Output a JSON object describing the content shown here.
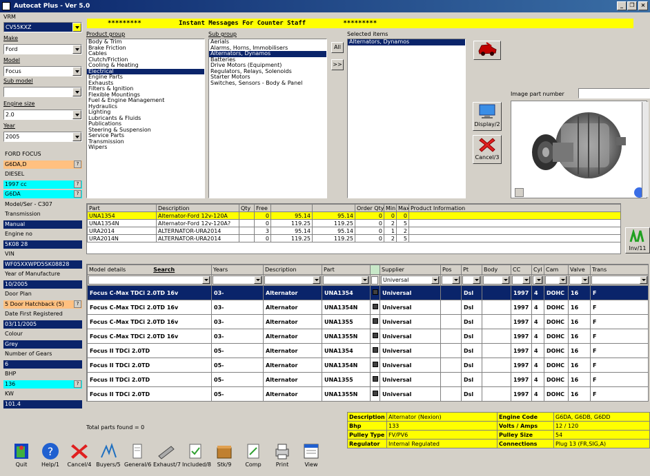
{
  "title": "Autocat Plus - Ver 5.0",
  "window_controls": {
    "min": "_",
    "restore": "❐",
    "close": "×"
  },
  "message": "*********          Instant Messages For Counter Staff          *********",
  "left": {
    "vrm_label": "VRM",
    "vrm_value": "CV55KXZ",
    "make_label": "Make",
    "make_value": "Ford",
    "model_label": "Model",
    "model_value": "Focus",
    "submodel_label": "Sub model",
    "submodel_value": "",
    "engine_label": "Engine size",
    "engine_value": "2.0",
    "year_label": "Year",
    "year_value": "2005",
    "rows": [
      {
        "text": "FORD FOCUS",
        "style": "gray",
        "btn": ""
      },
      {
        "text": "G6DA,D",
        "style": "orange",
        "btn": "?"
      },
      {
        "text": "DIESEL",
        "style": "gray",
        "btn": ""
      },
      {
        "text": "1997 cc",
        "style": "cyan",
        "btn": "?"
      },
      {
        "text": "G6DA",
        "style": "cyan",
        "btn": "?"
      },
      {
        "text": "Model/Ser - C307",
        "style": "gray",
        "btn": ""
      },
      {
        "text": "Transmission",
        "style": "gray",
        "btn": ""
      },
      {
        "text": "Manual",
        "style": "navy",
        "btn": ""
      },
      {
        "text": "Engine no",
        "style": "gray",
        "btn": ""
      },
      {
        "text": "5K08 28",
        "style": "navy",
        "btn": ""
      },
      {
        "text": "VIN",
        "style": "gray",
        "btn": ""
      },
      {
        "text": "WF05XXWPD5SK08828",
        "style": "navy",
        "btn": ""
      },
      {
        "text": "Year of Manufacture",
        "style": "gray",
        "btn": ""
      },
      {
        "text": "10/2005",
        "style": "navy",
        "btn": ""
      },
      {
        "text": "Door Plan",
        "style": "gray",
        "btn": ""
      },
      {
        "text": "5 Door Hatchback (5)",
        "style": "orange",
        "btn": "?"
      },
      {
        "text": "Date First Registered",
        "style": "gray",
        "btn": ""
      },
      {
        "text": "03/11/2005",
        "style": "navy",
        "btn": ""
      },
      {
        "text": "Colour",
        "style": "gray",
        "btn": ""
      },
      {
        "text": "Grey",
        "style": "navy",
        "btn": ""
      },
      {
        "text": "Number of Gears",
        "style": "gray",
        "btn": ""
      },
      {
        "text": "6",
        "style": "navy",
        "btn": ""
      },
      {
        "text": "BHP",
        "style": "gray",
        "btn": ""
      },
      {
        "text": "136",
        "style": "cyan",
        "btn": "?"
      },
      {
        "text": "KW",
        "style": "gray",
        "btn": ""
      },
      {
        "text": "101.4",
        "style": "navy",
        "btn": ""
      }
    ]
  },
  "product_group": {
    "label": "Product group",
    "items": [
      "Body & Trim",
      "Brake Friction",
      "Cables",
      "Clutch/Friction",
      "Cooling & Heating",
      "Electrical",
      "Engine Parts",
      "Exhausts",
      "Filters & Ignition",
      "Flexible Mountings",
      "Fuel & Engine Management",
      "Hydraulics",
      "Lighting",
      "Lubricants & Fluids",
      "Publications",
      "Steering & Suspension",
      "Service Parts",
      "Transmission",
      "Wipers"
    ],
    "selected": 5
  },
  "sub_group": {
    "label": "Sub group",
    "items": [
      "Aerials",
      "Alarms, Horns, Immobilisers",
      "Alternators, Dynamos",
      "Batteries",
      "Drive Motors (Equipment)",
      "Regulators, Relays, Solenoids",
      "Starter Motors",
      "Switches, Sensors - Body & Panel"
    ],
    "selected": 2
  },
  "selected_items": {
    "label": "Selected items",
    "items": [
      "Alternators, Dynamos"
    ]
  },
  "all_button": "All",
  "fwd_button": ">>",
  "image_label": "Image part number",
  "display_button": "Display/2",
  "cancel_button": "Cancel/3",
  "parts_table": {
    "headers": [
      "Part",
      "Description",
      "Qty",
      "Free",
      "",
      "",
      "Order Qty",
      "Min",
      "Max",
      "Product Information"
    ],
    "rows": [
      {
        "cells": [
          "UNA1354",
          "Alternator-Ford 12v-120A",
          "",
          "0",
          "95.14",
          "95.14",
          "0",
          "0",
          "0",
          ""
        ],
        "style": "y"
      },
      {
        "cells": [
          "UNA1354N",
          "Alternator-Ford 12v-120A?",
          "",
          "0",
          "119.25",
          "119.25",
          "0",
          "2",
          "5",
          ""
        ],
        "style": "w"
      },
      {
        "cells": [
          "URA2014",
          "ALTERNATOR-URA2014",
          "",
          "3",
          "95.14",
          "95.14",
          "0",
          "1",
          "2",
          ""
        ],
        "style": "w"
      },
      {
        "cells": [
          "URA2014N",
          "ALTERNATOR-URA2014",
          "",
          "0",
          "119.25",
          "119.25",
          "0",
          "2",
          "5",
          ""
        ],
        "style": "w"
      }
    ]
  },
  "inv_button": "Inv/11",
  "model_table": {
    "headers": [
      "Model details",
      "Search",
      "Years",
      "Description",
      "Part",
      "",
      "Supplier",
      "Pos",
      "Pt",
      "Body",
      "CC",
      "Cyl",
      "Cam",
      "Valve",
      "Trans"
    ],
    "supplier_filter": "Universal",
    "rows": [
      [
        "Focus C-Max TDCi 2.0TD 16v",
        "03-",
        "Alternator",
        "UNA1354",
        "Universal",
        "",
        "Dsl",
        "",
        "1997",
        "4",
        "DOHC",
        "16",
        "F"
      ],
      [
        "Focus C-Max TDCi 2.0TD 16v",
        "03-",
        "Alternator",
        "UNA1354N",
        "Universal",
        "",
        "Dsl",
        "",
        "1997",
        "4",
        "DOHC",
        "16",
        "F"
      ],
      [
        "Focus C-Max TDCi 2.0TD 16v",
        "03-",
        "Alternator",
        "UNA1355",
        "Universal",
        "",
        "Dsl",
        "",
        "1997",
        "4",
        "DOHC",
        "16",
        "F"
      ],
      [
        "Focus C-Max TDCi 2.0TD 16v",
        "03-",
        "Alternator",
        "UNA1355N",
        "Universal",
        "",
        "Dsl",
        "",
        "1997",
        "4",
        "DOHC",
        "16",
        "F"
      ],
      [
        "Focus II TDCi 2.0TD",
        "05-",
        "Alternator",
        "UNA1354",
        "Universal",
        "",
        "Dsl",
        "",
        "1997",
        "4",
        "DOHC",
        "16",
        "F"
      ],
      [
        "Focus II TDCi 2.0TD",
        "05-",
        "Alternator",
        "UNA1354N",
        "Universal",
        "",
        "Dsl",
        "",
        "1997",
        "4",
        "DOHC",
        "16",
        "F"
      ],
      [
        "Focus II TDCi 2.0TD",
        "05-",
        "Alternator",
        "UNA1355",
        "Universal",
        "",
        "Dsl",
        "",
        "1997",
        "4",
        "DOHC",
        "16",
        "F"
      ],
      [
        "Focus II TDCi 2.0TD",
        "05-",
        "Alternator",
        "UNA1355N",
        "Universal",
        "",
        "Dsl",
        "",
        "1997",
        "4",
        "DOHC",
        "16",
        "F"
      ]
    ]
  },
  "total_parts": "Total parts found = 0",
  "details": {
    "rows": [
      [
        "Description",
        "Alternator (Nexion)",
        "Engine Code",
        "G6DA, G6DB, G6DD"
      ],
      [
        "Bhp",
        "133",
        "Volts / Amps",
        "12 / 120"
      ],
      [
        "Pulley Type",
        "FV/PV6",
        "Pulley Size",
        "54"
      ],
      [
        "Regulator",
        "Internal Regulated",
        "Connections",
        "Plug 13 (FR,SIG,A)"
      ]
    ]
  },
  "toolbar": [
    {
      "label": "Quit",
      "icon": "quit-icon"
    },
    {
      "label": "Help/1",
      "icon": "help-icon"
    },
    {
      "label": "Cancel/4",
      "icon": "cancel-icon"
    },
    {
      "label": "Buyers/5",
      "icon": "buyers-icon"
    },
    {
      "label": "General/6",
      "icon": "general-icon"
    },
    {
      "label": "Exhaust/7",
      "icon": "exhaust-icon"
    },
    {
      "label": "Included/8",
      "icon": "included-icon"
    },
    {
      "label": "Stk/9",
      "icon": "stock-icon"
    },
    {
      "label": "Comp",
      "icon": "comp-icon"
    },
    {
      "label": "Print",
      "icon": "print-icon"
    },
    {
      "label": "View",
      "icon": "view-icon"
    }
  ],
  "colors": {
    "navy": "#0a246a",
    "yellow": "#ffff00",
    "cyan": "#00ffff",
    "orange": "#ffc080"
  }
}
